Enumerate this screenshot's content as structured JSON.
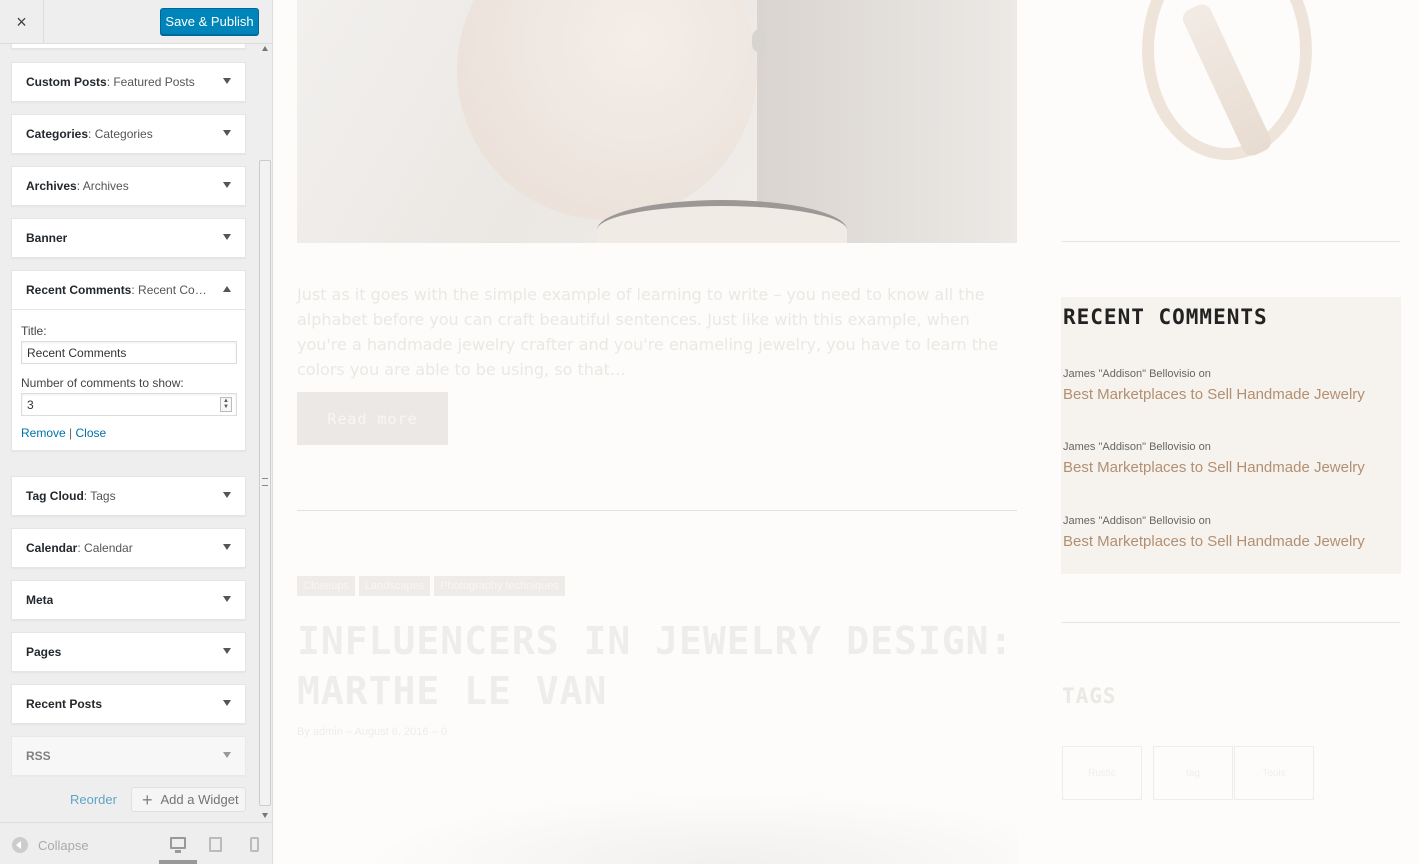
{
  "header": {
    "close_icon": "×",
    "save_label": "Save & Publish"
  },
  "widgets": [
    {
      "name": "Custom Posts",
      "sub": ": Featured Posts"
    },
    {
      "name": "Categories",
      "sub": ": Categories"
    },
    {
      "name": "Archives",
      "sub": ": Archives"
    },
    {
      "name": "Banner",
      "sub": ""
    },
    {
      "name": "Recent Comments",
      "sub": ": Recent Co…",
      "expanded": true
    },
    {
      "name": "Tag Cloud",
      "sub": ": Tags"
    },
    {
      "name": "Calendar",
      "sub": ": Calendar"
    },
    {
      "name": "Meta",
      "sub": ""
    },
    {
      "name": "Pages",
      "sub": ""
    },
    {
      "name": "Recent Posts",
      "sub": ""
    },
    {
      "name": "RSS",
      "sub": ""
    }
  ],
  "recent_comments_form": {
    "title_label": "Title:",
    "title_value": "Recent Comments",
    "count_label": "Number of comments to show:",
    "count_value": "3",
    "remove_label": "Remove",
    "separator": "|",
    "close_label": "Close"
  },
  "footer_actions": {
    "reorder_label": "Reorder",
    "add_widget_label": "Add a Widget",
    "collapse_label": "Collapse"
  },
  "preview": {
    "excerpt": "Just as it goes with the simple example of learning to write – you need to know all the alphabet before you can craft beautiful sentences. Just like with this example, when you're a handmade jewelry crafter and you're enameling jewelry, you have to learn the colors you are able to be using, so that…",
    "read_more": "Read more",
    "post_tags": [
      "Closeups",
      "Landscapes",
      "Photography techniques"
    ],
    "post_title": "INFLUENCERS IN JEWELRY DESIGN: MARTHE LE VAN",
    "post_meta": "By admin – August 6, 2016 – 0",
    "sidebar": {
      "recent_comments_title": "RECENT COMMENTS",
      "comments": [
        {
          "author": "James \"Addison\" Bellovisio on",
          "link": "Best Marketplaces to Sell Handmade Jewelry"
        },
        {
          "author": "James \"Addison\" Bellovisio on",
          "link": "Best Marketplaces to Sell Handmade Jewelry"
        },
        {
          "author": "James \"Addison\" Bellovisio on",
          "link": "Best Marketplaces to Sell Handmade Jewelry"
        }
      ],
      "tags_title": "TAGS",
      "tag_boxes": [
        "Rustic",
        "tag",
        "Tools"
      ]
    }
  },
  "colors": {
    "primary_button": "#0085ba",
    "link": "#0073aa",
    "accent_link": "#b38f71",
    "widget_bg": "#f6f3ee"
  }
}
